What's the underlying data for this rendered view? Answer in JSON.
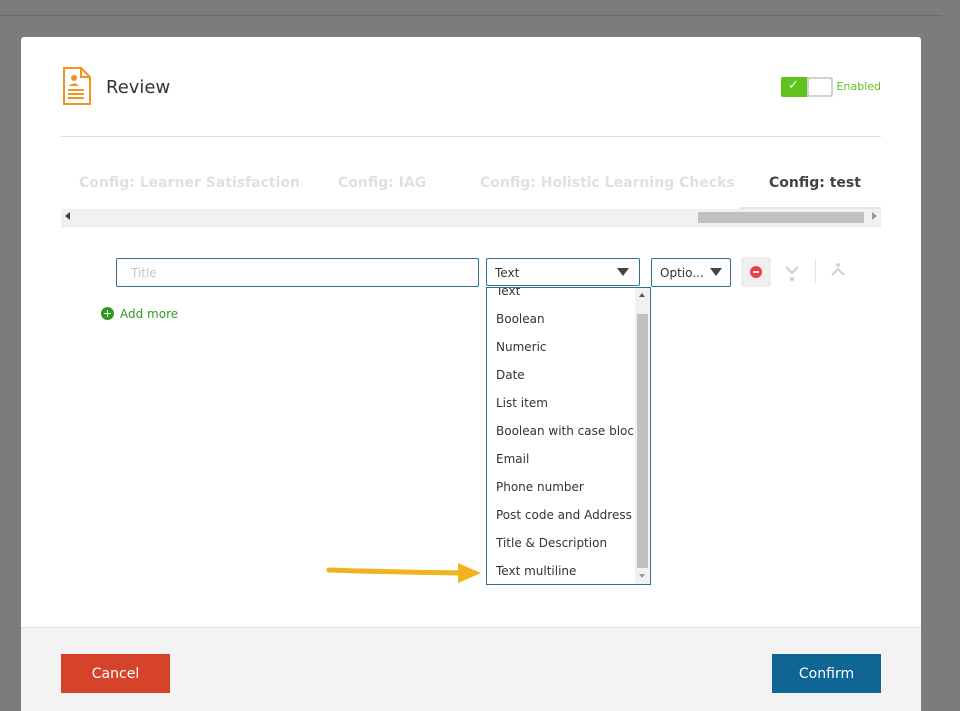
{
  "modal": {
    "title": "Review"
  },
  "toggle": {
    "label": "Enabled",
    "checked": true,
    "color": "#5fc21d"
  },
  "tabs": [
    {
      "label": "Config: Learner Satisfaction",
      "active": false
    },
    {
      "label": "Config: IAG",
      "active": false
    },
    {
      "label": "Config: Holistic Learning Checks",
      "active": false
    },
    {
      "label": "Config: test",
      "active": true
    }
  ],
  "field": {
    "title_placeholder": "Title",
    "type_value": "Text",
    "option_value": "Optio..."
  },
  "add_more": {
    "label": "Add more"
  },
  "type_dropdown": {
    "items": [
      "Text",
      "Boolean",
      "Numeric",
      "Date",
      "List item",
      "Boolean with case block",
      "Email",
      "Phone number",
      "Post code and Address",
      "Title & Description",
      "Text multiline"
    ]
  },
  "icons": {
    "header": "review-document-icon",
    "remove": "remove-circle-icon",
    "move_down": "move-down-icon",
    "move_up": "move-up-icon",
    "add": "plus-circle-icon",
    "annotation": "arrow-right-annotation"
  },
  "colors": {
    "accent": "#0f6694",
    "danger": "#d5432a",
    "success": "#2d9b22",
    "icon_orange": "#f39123",
    "annotation_arrow": "#f0b31b"
  },
  "footer": {
    "cancel_label": "Cancel",
    "confirm_label": "Confirm"
  }
}
